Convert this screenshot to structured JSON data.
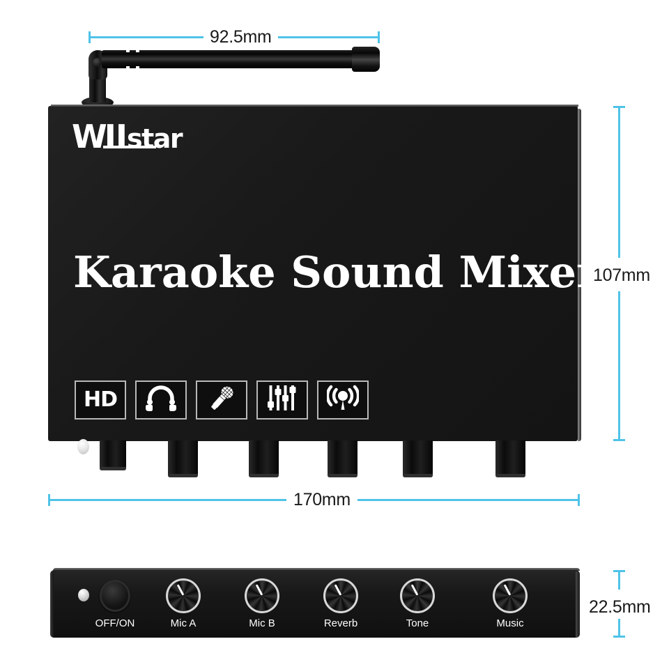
{
  "product": {
    "brand_logo": {
      "part_w": "W",
      "part_ii": "II",
      "part_star": "star",
      "full": "Wiistar"
    },
    "title": "Karaoke Sound Mixer",
    "body_color": "#1a1a1a"
  },
  "dimensions": {
    "accent_color": "#4fc3e8",
    "antenna_length": "92.5mm",
    "body_height": "107mm",
    "body_width": "170mm",
    "panel_height": "22.5mm"
  },
  "features": [
    {
      "name": "hd-badge",
      "label": "HD",
      "icon": "hd-icon"
    },
    {
      "name": "headphones",
      "label": "",
      "icon": "headphones-icon"
    },
    {
      "name": "microphone",
      "label": "",
      "icon": "microphone-icon"
    },
    {
      "name": "equalizer",
      "label": "",
      "icon": "equalizer-icon"
    },
    {
      "name": "wireless",
      "label": "",
      "icon": "wireless-signal-icon"
    }
  ],
  "front_panel": {
    "led_indicator": "power-led",
    "power_button": "OFF/ON",
    "knobs": [
      {
        "label": "Mic A"
      },
      {
        "label": "Mic B"
      },
      {
        "label": "Reverb"
      },
      {
        "label": "Tone"
      },
      {
        "label": "Music"
      }
    ]
  },
  "rear": {
    "shaft_count": 6,
    "led": "rear-led"
  }
}
